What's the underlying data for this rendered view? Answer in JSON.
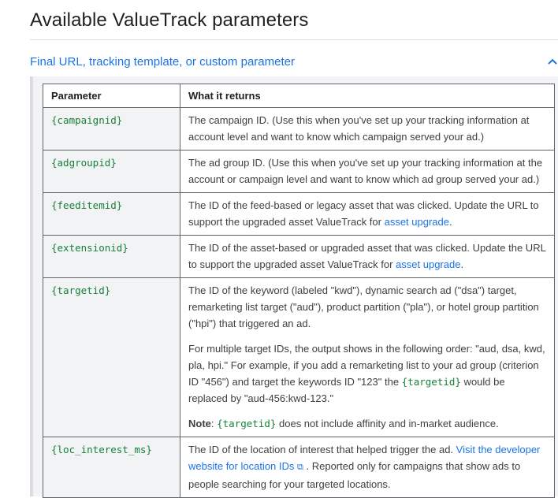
{
  "page": {
    "title": "Available ValueTrack parameters"
  },
  "section": {
    "header": "Final URL, tracking template, or custom parameter",
    "chevron_icon": "chevron-up-icon"
  },
  "table": {
    "headers": {
      "parameter": "Parameter",
      "returns": "What it returns"
    },
    "rows": [
      {
        "param": "{campaignid}",
        "desc": "The campaign ID. (Use this when you've set up your tracking information at account level and want to know which campaign served your ad.)"
      },
      {
        "param": "{adgroupid}",
        "desc": "The ad group ID. (Use this when you've set up your tracking information at the account or campaign level and want to know which ad group served your ad.)"
      },
      {
        "param": "{feeditemid}",
        "desc": "The ID of the feed-based or legacy asset that was clicked. Update the URL to support the upgraded asset ValueTrack for ",
        "link": "asset upgrade",
        "after": "."
      },
      {
        "param": "{extensionid}",
        "desc": "The ID of the asset-based or upgraded asset that was clicked. Update the URL to support the upgraded asset ValueTrack for ",
        "link": "asset upgrade",
        "after": "."
      },
      {
        "param": "{targetid}",
        "p1": "The ID of the keyword (labeled \"kwd\"), dynamic search ad (\"dsa\") target, remarketing list target (\"aud\"), product partition (\"pla\"), or hotel group partition (\"hpi\") that triggered an ad.",
        "p2_before": "For multiple target IDs, the output shows in the following order: \"aud, dsa, kwd, pla, hpi.\" For example, if you add a remarketing list to your ad group (criterion ID \"456\") and target the keywords ID \"123\" the ",
        "p2_code": "{targetid}",
        "p2_after": " would be replaced by \"aud-456:kwd-123.\"",
        "note_label": "Note",
        "note_sep": ": ",
        "note_code": "{targetid}",
        "note_after": " does not include affinity and in-market audience."
      },
      {
        "param": "{loc_interest_ms}",
        "desc": "The ID of the location of interest that helped trigger the ad. ",
        "link": "Visit the developer website for location IDs",
        "link_icon": "external-link-icon",
        "after": " . Reported only for campaigns that show ads to people searching for your targeted locations."
      }
    ]
  }
}
